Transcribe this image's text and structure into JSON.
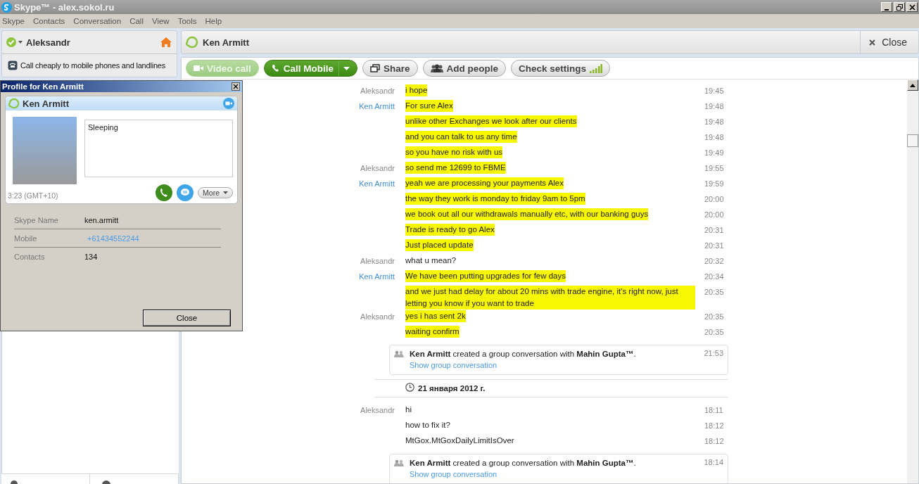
{
  "window": {
    "title": "Skype™ - alex.sokol.ru"
  },
  "menu": [
    "Skype",
    "Contacts",
    "Conversation",
    "Call",
    "View",
    "Tools",
    "Help"
  ],
  "sidebar": {
    "user": "Aleksandr",
    "promo": "Call cheaply to mobile phones and landlines"
  },
  "conversation": {
    "contact": "Ken Armitt",
    "close_label": "Close",
    "toolbar": [
      {
        "label": "Video call",
        "kind": "video",
        "disabled": true
      },
      {
        "label": "Call Mobile",
        "kind": "call",
        "disabled": false
      },
      {
        "label": "Share",
        "kind": "share",
        "disabled": false
      },
      {
        "label": "Add people",
        "kind": "people",
        "disabled": false
      },
      {
        "label": "Check settings",
        "kind": "signal",
        "disabled": false
      }
    ],
    "messages": [
      {
        "kind": "message",
        "sender": "Aleksandr",
        "from_me": true,
        "text": "i hope",
        "time": "19:45",
        "highlighted": true
      },
      {
        "kind": "message",
        "sender": "Ken Armitt",
        "from_me": false,
        "text": "For sure Alex",
        "time": "19:48",
        "highlighted": true
      },
      {
        "kind": "message",
        "text": "unlike other Exchanges we look after our clients",
        "time": "19:48",
        "highlighted": true
      },
      {
        "kind": "message",
        "text": "and you can talk to us any time",
        "time": "19:48",
        "highlighted": true
      },
      {
        "kind": "message",
        "text": "so you have no risk with us",
        "time": "19:49",
        "highlighted": true
      },
      {
        "kind": "message",
        "sender": "Aleksandr",
        "from_me": true,
        "text": "so send me 12699 to FBME",
        "time": "19:55",
        "highlighted": true
      },
      {
        "kind": "message",
        "sender": "Ken Armitt",
        "from_me": false,
        "text": "yeah we are processing your payments Alex",
        "time": "19:59",
        "highlighted": true
      },
      {
        "kind": "message",
        "text": "the way they work is monday to friday 9am to 5pm",
        "time": "20:00",
        "highlighted": true
      },
      {
        "kind": "message",
        "text": "we book out all our withdrawals manually etc, with our banking guys",
        "time": "20:00",
        "highlighted": true
      },
      {
        "kind": "message",
        "text": "Trade is ready to go Alex",
        "time": "20:31",
        "highlighted": true
      },
      {
        "kind": "message",
        "text": "Just placed update",
        "time": "20:31",
        "highlighted": true
      },
      {
        "kind": "message",
        "sender": "Aleksandr",
        "from_me": true,
        "text": "what u mean?",
        "time": "20:32",
        "highlighted": false
      },
      {
        "kind": "message",
        "sender": "Ken Armitt",
        "from_me": false,
        "text": "We have been putting upgrades for few days",
        "time": "20:34",
        "highlighted": true
      },
      {
        "kind": "message",
        "text": "and we just had delay for about 20 mins with trade engine, it's right now, just letting you know if you want to trade",
        "time": "20:35",
        "highlighted": true
      },
      {
        "kind": "message",
        "sender": "Aleksandr",
        "from_me": true,
        "text": "yes i has sent 2k",
        "time": "20:35",
        "highlighted": true
      },
      {
        "kind": "message",
        "text": "waiting confirm",
        "time": "20:35",
        "highlighted": true
      },
      {
        "kind": "event",
        "text": "**Ken Armitt** created a group conversation with **Mahin Gupta™**.",
        "link": "Show group conversation",
        "time": "21:53"
      },
      {
        "kind": "date",
        "text": "21 января 2012 г."
      },
      {
        "kind": "message",
        "sender": "Aleksandr",
        "from_me": true,
        "text": "hi",
        "time": "18:11",
        "highlighted": false
      },
      {
        "kind": "message",
        "text": "how to fix it?",
        "time": "18:12",
        "highlighted": false
      },
      {
        "kind": "message",
        "text": "MtGox.MtGoxDailyLimitIsOver",
        "time": "18:12",
        "highlighted": false
      },
      {
        "kind": "event",
        "text": "**Ken Armitt** created a group conversation with **Mahin Gupta™**.",
        "link": "Show group conversation",
        "time": "18:14"
      }
    ]
  },
  "profile": {
    "title": "Profile for Ken Armitt",
    "name": "Ken Armitt",
    "mood": "Sleeping",
    "local_time": "3:23 (GMT+10)",
    "more_label": "More",
    "fields": [
      {
        "label": "Skype Name",
        "value": "ken.armitt",
        "kind": "text"
      },
      {
        "label": "Mobile",
        "value": "+61434552244",
        "kind": "link"
      },
      {
        "label": "Contacts",
        "value": "134",
        "kind": "text"
      }
    ],
    "close_label": "Close"
  }
}
